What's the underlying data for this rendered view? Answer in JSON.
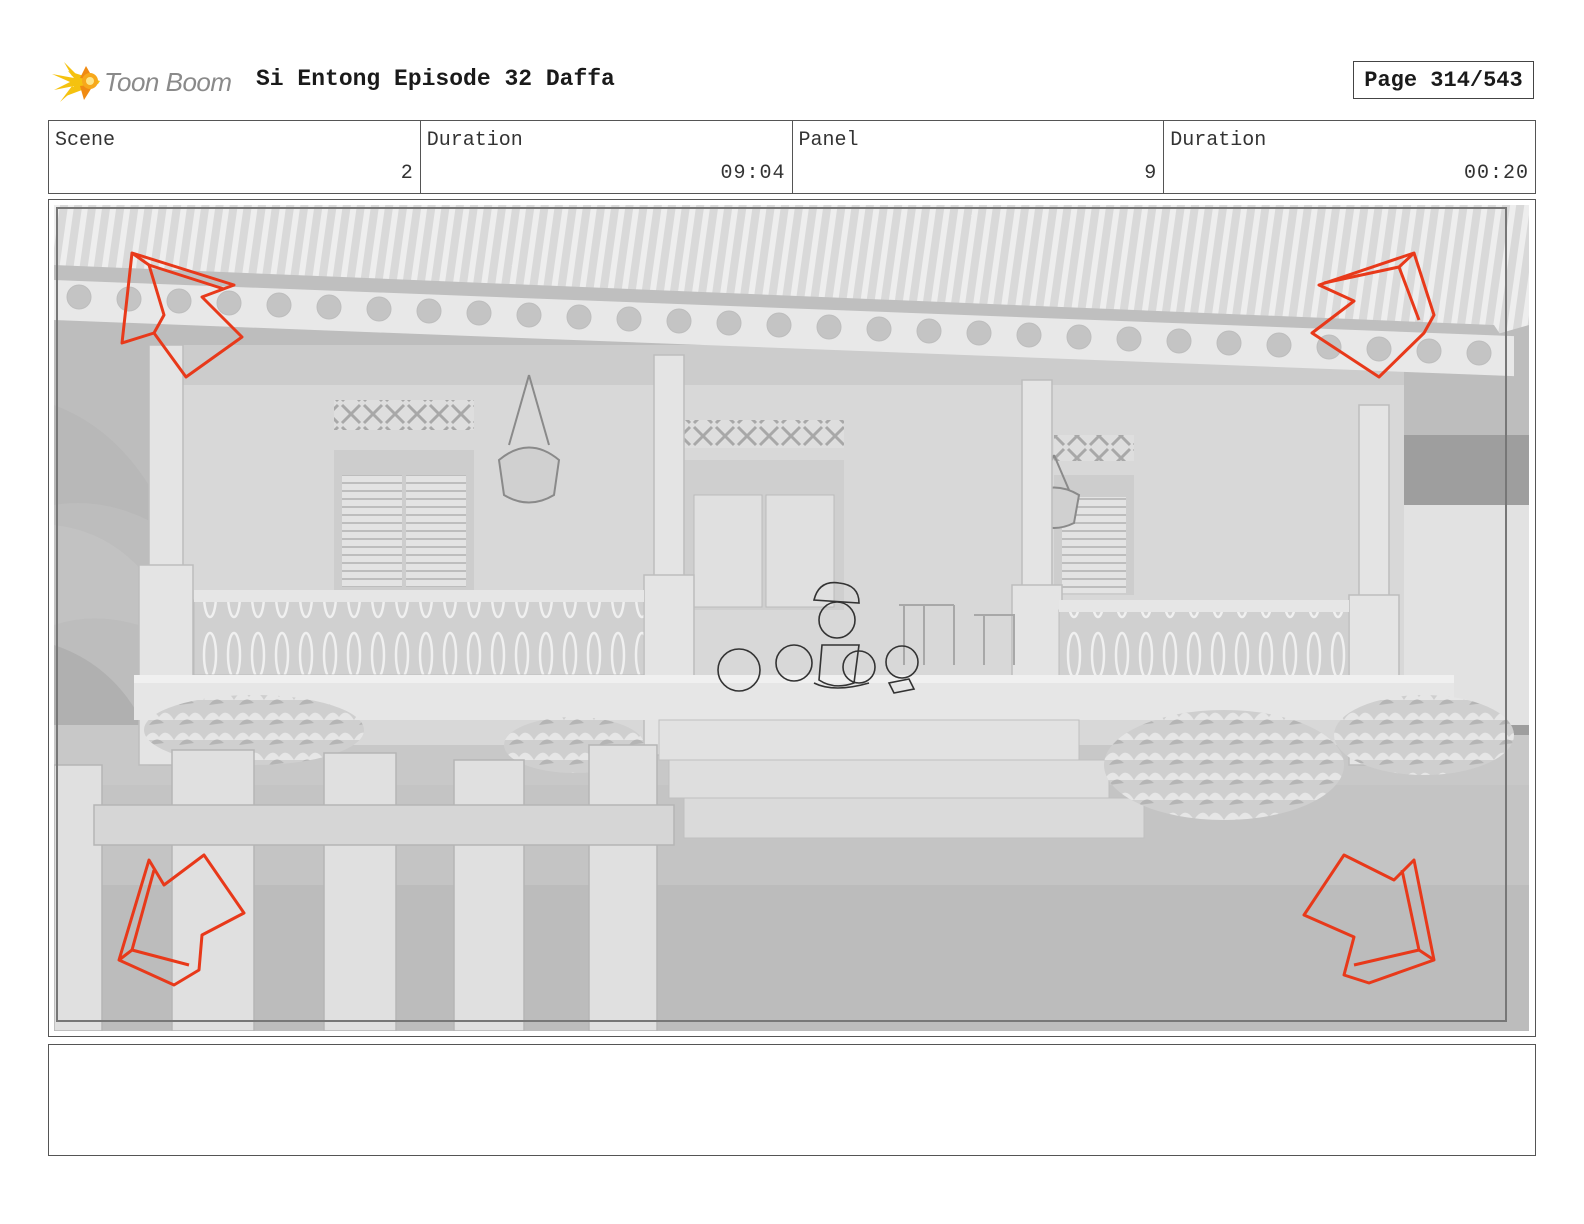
{
  "header": {
    "logo_text": "Toon Boom",
    "title": "Si Entong Episode 32 Daffa",
    "page": "Page 314/543"
  },
  "info": [
    {
      "label": "Scene",
      "value": "2"
    },
    {
      "label": "Duration",
      "value": "09:04"
    },
    {
      "label": "Panel",
      "value": "9"
    },
    {
      "label": "Duration",
      "value": "00:20"
    }
  ],
  "notes": "",
  "colors": {
    "arrow": "#e8391a",
    "logo_yellow": "#f5c20f",
    "logo_orange": "#f08a12"
  },
  "icons": [
    "toon-boom-logo-icon",
    "camera-push-arrow-icon"
  ]
}
